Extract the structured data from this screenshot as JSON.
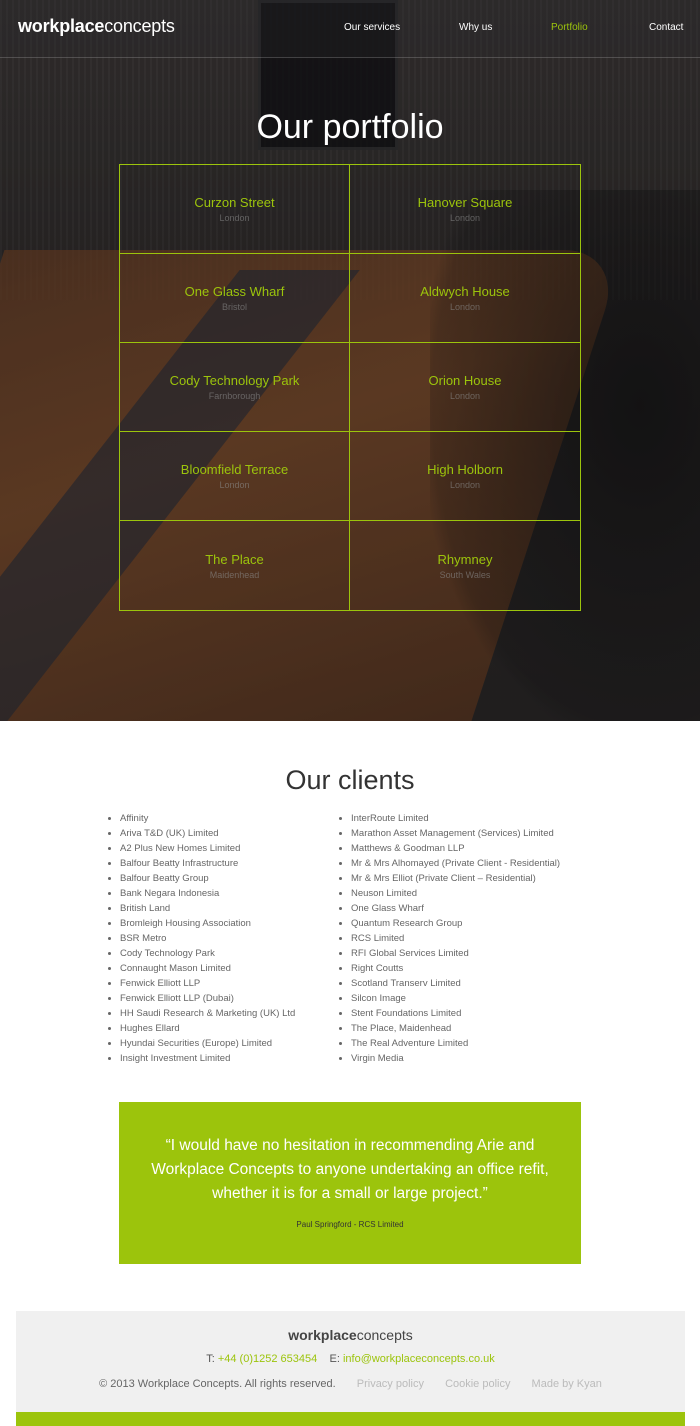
{
  "header": {
    "logo_bold": "workplace",
    "logo_light": "concepts",
    "nav": [
      {
        "label": "Our services"
      },
      {
        "label": "Why us"
      },
      {
        "label": "Portfolio",
        "active": true
      },
      {
        "label": "Contact"
      }
    ]
  },
  "portfolio": {
    "title": "Our portfolio",
    "projects": [
      {
        "name": "Curzon Street",
        "location": "London"
      },
      {
        "name": "Hanover Square",
        "location": "London"
      },
      {
        "name": "One Glass Wharf",
        "location": "Bristol"
      },
      {
        "name": "Aldwych House",
        "location": "London"
      },
      {
        "name": "Cody Technology Park",
        "location": "Farnborough"
      },
      {
        "name": "Orion House",
        "location": "London"
      },
      {
        "name": "Bloomfield Terrace",
        "location": "London"
      },
      {
        "name": "High Holborn",
        "location": "London"
      },
      {
        "name": "The Place",
        "location": "Maidenhead"
      },
      {
        "name": "Rhymney",
        "location": "South Wales"
      }
    ]
  },
  "clients": {
    "title": "Our clients",
    "left": [
      "Affinity",
      "Ariva T&D (UK) Limited",
      "A2 Plus New Homes Limited",
      "Balfour Beatty Infrastructure",
      "Balfour Beatty Group",
      "Bank Negara Indonesia",
      "British Land",
      "Bromleigh Housing Association",
      "BSR Metro",
      "Cody Technology Park",
      "Connaught Mason Limited",
      "Fenwick Elliott LLP",
      "Fenwick Elliott LLP (Dubai)",
      "HH Saudi Research & Marketing (UK) Ltd",
      "Hughes Ellard",
      "Hyundai Securities (Europe) Limited",
      "Insight Investment Limited"
    ],
    "right": [
      "InterRoute Limited",
      "Marathon Asset Management (Services) Limited",
      "Matthews & Goodman LLP",
      "Mr & Mrs Alhomayed (Private Client - Residential)",
      "Mr & Mrs Elliot (Private Client – Residential)",
      "Neuson Limited",
      "One Glass Wharf",
      "Quantum Research Group",
      "RCS Limited",
      "RFI Global Services Limited",
      "Right Coutts",
      "Scotland Transerv Limited",
      "Silcon Image",
      "Stent Foundations Limited",
      "The Place, Maidenhead",
      "The Real Adventure Limited",
      "Virgin Media"
    ]
  },
  "testimonial": {
    "quote": "“I would have no hesitation in recommending Arie and Workplace Concepts to anyone undertaking an office refit, whether it is for a small or large project.”",
    "author": "Paul Springford - RCS Limited"
  },
  "footer": {
    "logo_bold": "workplace",
    "logo_light": "concepts",
    "phone_prefix": "T:",
    "phone": "+44 (0)1252 653454",
    "email_prefix": "E:",
    "email": "info@workplaceconcepts.co.uk",
    "copyright": "© 2013 Workplace Concepts. All rights reserved.",
    "links": [
      "Privacy policy",
      "Cookie policy",
      "Made by Kyan"
    ]
  },
  "colors": {
    "accent": "#9cc40c",
    "footer_bg": "#f0f0f0",
    "text_dark": "#333333"
  }
}
